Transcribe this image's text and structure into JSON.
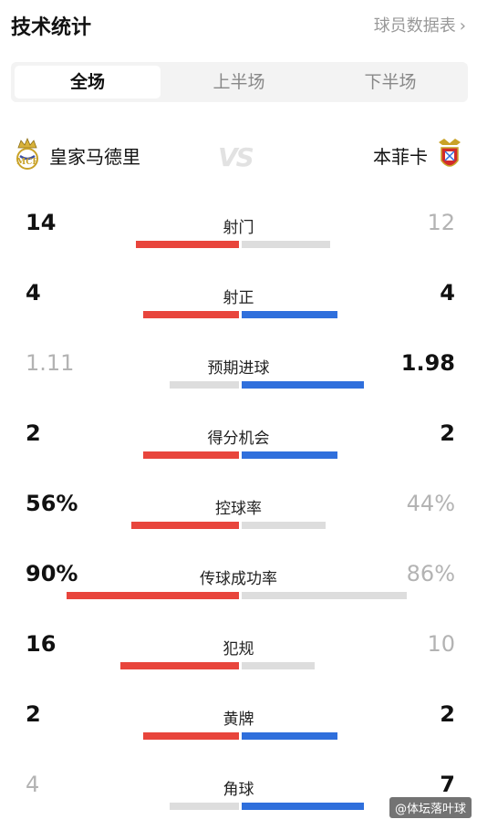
{
  "header": {
    "title": "技术统计",
    "data_link": "球员数据表",
    "chevron": "›"
  },
  "tabs": [
    {
      "label": "全场",
      "active": true
    },
    {
      "label": "上半场",
      "active": false
    },
    {
      "label": "下半场",
      "active": false
    }
  ],
  "teams": {
    "home": {
      "name": "皇家马德里",
      "crest": "real-madrid-crest",
      "color": "#e8453c"
    },
    "away": {
      "name": "本菲卡",
      "crest": "benfica-crest",
      "color": "#2f6fdc"
    },
    "vs": "VS"
  },
  "stats": [
    {
      "label": "射门",
      "home": "14",
      "away": "12",
      "home_share": 0.54,
      "away_share": 0.46,
      "leader": "home"
    },
    {
      "label": "射正",
      "home": "4",
      "away": "4",
      "home_share": 0.5,
      "away_share": 0.5,
      "leader": "both"
    },
    {
      "label": "预期进球",
      "home": "1.11",
      "away": "1.98",
      "home_share": 0.36,
      "away_share": 0.64,
      "leader": "away"
    },
    {
      "label": "得分机会",
      "home": "2",
      "away": "2",
      "home_share": 0.5,
      "away_share": 0.5,
      "leader": "both"
    },
    {
      "label": "控球率",
      "home": "56%",
      "away": "44%",
      "home_share": 0.56,
      "away_share": 0.44,
      "leader": "home"
    },
    {
      "label": "传球成功率",
      "home": "90%",
      "away": "86%",
      "home_share": 0.9,
      "away_share": 0.86,
      "leader": "home"
    },
    {
      "label": "犯规",
      "home": "16",
      "away": "10",
      "home_share": 0.62,
      "away_share": 0.38,
      "leader": "home"
    },
    {
      "label": "黄牌",
      "home": "2",
      "away": "2",
      "home_share": 0.5,
      "away_share": 0.5,
      "leader": "both"
    },
    {
      "label": "角球",
      "home": "4",
      "away": "7",
      "home_share": 0.36,
      "away_share": 0.64,
      "leader": "away"
    }
  ],
  "watermark": "@体坛落叶球"
}
